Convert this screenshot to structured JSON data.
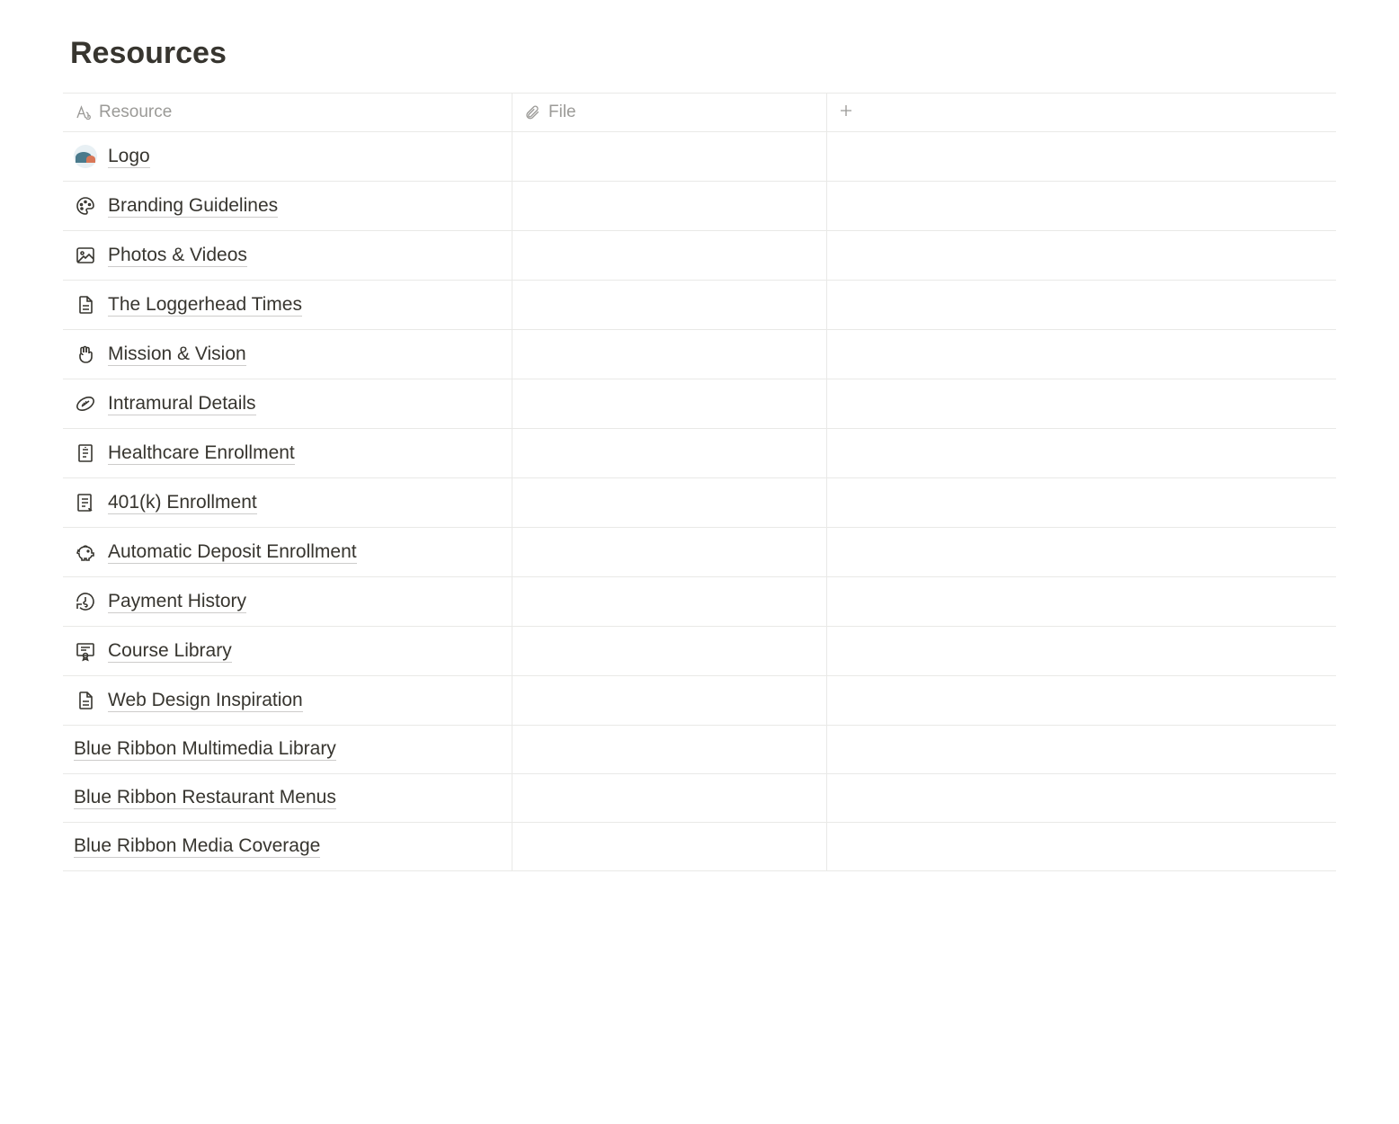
{
  "title": "Resources",
  "columns": {
    "resource": {
      "label": "Resource",
      "icon": "text-icon"
    },
    "file": {
      "label": "File",
      "icon": "attachment-icon"
    }
  },
  "rows": [
    {
      "icon": "logo-icon",
      "title": "Logo"
    },
    {
      "icon": "palette-icon",
      "title": "Branding Guidelines"
    },
    {
      "icon": "image-icon",
      "title": "Photos & Videos"
    },
    {
      "icon": "page-icon",
      "title": "The Loggerhead Times"
    },
    {
      "icon": "peace-icon",
      "title": "Mission & Vision"
    },
    {
      "icon": "football-icon",
      "title": "Intramural Details"
    },
    {
      "icon": "receipt-icon",
      "title": "Healthcare Enrollment"
    },
    {
      "icon": "document-icon",
      "title": "401(k) Enrollment"
    },
    {
      "icon": "piggy-icon",
      "title": "Automatic Deposit Enrollment"
    },
    {
      "icon": "history-icon",
      "title": "Payment History"
    },
    {
      "icon": "certificate-icon",
      "title": "Course Library"
    },
    {
      "icon": "page-icon",
      "title": "Web Design Inspiration"
    },
    {
      "icon": "",
      "title": "Blue Ribbon Multimedia Library"
    },
    {
      "icon": "",
      "title": "Blue Ribbon Restaurant Menus"
    },
    {
      "icon": "",
      "title": "Blue Ribbon Media Coverage"
    }
  ]
}
